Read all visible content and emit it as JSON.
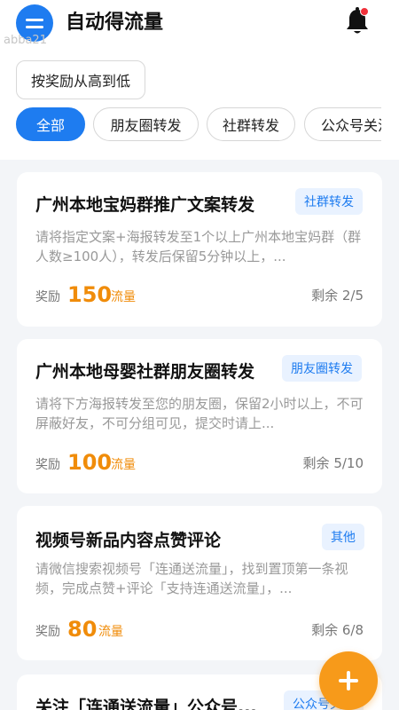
{
  "header": {
    "title": "自动得流量",
    "watermark": "abba21",
    "menu_icon": "menu-icon",
    "bell_icon": "bell-icon",
    "accent": "#1e7cf0"
  },
  "sort": {
    "label": "按奖励从高到低"
  },
  "tabs": [
    {
      "label": "全部",
      "active": true
    },
    {
      "label": "朋友圈转发",
      "active": false
    },
    {
      "label": "社群转发",
      "active": false
    },
    {
      "label": "公众号关注",
      "active": false
    }
  ],
  "tasks": [
    {
      "title": "广州本地宝妈群推广文案转发",
      "tag": "社群转发",
      "desc": "请将指定文案+海报转发至1个以上广州本地宝妈群（群人数≥100人），转发后保留5分钟以上，...",
      "reward_label": "奖励",
      "reward_value": "150",
      "reward_unit": "流量",
      "remaining": "剩余 2/5"
    },
    {
      "title": "广州本地母婴社群朋友圈转发",
      "tag": "朋友圈转发",
      "desc": "请将下方海报转发至您的朋友圈，保留2小时以上，不可屏蔽好友，不可分组可见，提交时请上...",
      "reward_label": "奖励",
      "reward_value": "100",
      "reward_unit": "流量",
      "remaining": "剩余 5/10"
    },
    {
      "title": "视频号新品内容点赞评论",
      "tag": "其他",
      "desc": "请微信搜索视频号「连通送流量」，找到置顶第一条视频，完成点赞+评论「支持连通送流量」，...",
      "reward_label": "奖励",
      "reward_value": "80",
      "reward_unit": "流量",
      "remaining": "剩余 6/8"
    },
    {
      "title": "关注「连通送流量」公众号...",
      "tag": "公众号关注"
    }
  ],
  "fab": {
    "icon": "plus-icon",
    "color": "#f79a1a"
  }
}
